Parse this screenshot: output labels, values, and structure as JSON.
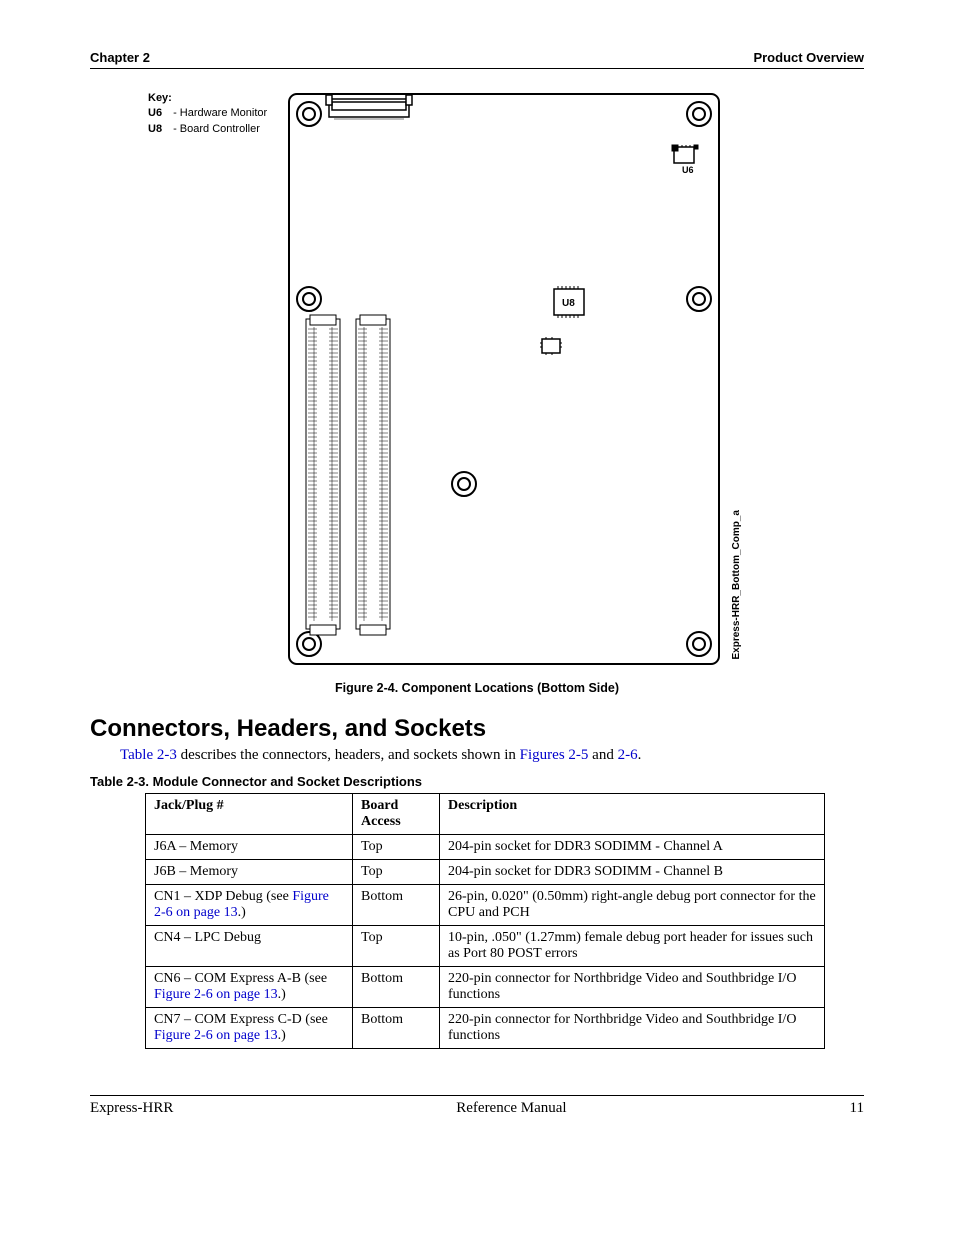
{
  "header": {
    "left": "Chapter 2",
    "right": "Product Overview"
  },
  "figure": {
    "key_title": "Key:",
    "key_items": [
      {
        "id": "U6",
        "desc": "- Hardware Monitor"
      },
      {
        "id": "U8",
        "desc": "- Board Controller"
      }
    ],
    "chip_u6": "U6",
    "chip_u8": "U8",
    "side_label": "Express-HRR_Bottom_Comp_a",
    "caption": "Figure  2-4.   Component Locations (Bottom Side)"
  },
  "section_title": "Connectors, Headers, and Sockets",
  "intro": {
    "pre": "",
    "link1": "Table 2-3",
    "mid": " describes the connectors, headers, and sockets shown in ",
    "link2": "Figures 2-5",
    "mid2": " and ",
    "link3": "2-6",
    "post": "."
  },
  "table": {
    "caption": "Table 2-3.   Module Connector and Socket Descriptions",
    "headers": [
      "Jack/Plug #",
      "Board Access",
      "Description"
    ],
    "rows": [
      {
        "col1_plain": "J6A – Memory",
        "col1_link": "",
        "col1_post": "",
        "col2": "Top",
        "col3": "204-pin socket for DDR3 SODIMM - Channel A"
      },
      {
        "col1_plain": "J6B – Memory",
        "col1_link": "",
        "col1_post": "",
        "col2": "Top",
        "col3": "204-pin socket for DDR3 SODIMM - Channel B"
      },
      {
        "col1_plain": "CN1 – XDP Debug (see ",
        "col1_link": "Figure 2-6 on page 13",
        "col1_post": ".)",
        "col2": "Bottom",
        "col3": "26-pin, 0.020\" (0.50mm) right-angle debug port connector for the CPU and PCH"
      },
      {
        "col1_plain": "CN4 – LPC Debug",
        "col1_link": "",
        "col1_post": "",
        "col2": "Top",
        "col3": "10-pin, .050\" (1.27mm) female debug port header for issues such as Port 80 POST errors"
      },
      {
        "col1_plain": "CN6 – COM Express A-B (see ",
        "col1_link": "Figure 2-6 on page 13",
        "col1_post": ".)",
        "col2": "Bottom",
        "col3": "220-pin connector for Northbridge Video and Southbridge I/O functions"
      },
      {
        "col1_plain": "CN7 – COM Express C-D (see ",
        "col1_link": "Figure 2-6 on page 13",
        "col1_post": ".)",
        "col2": "Bottom",
        "col3": "220-pin connector for Northbridge Video and Southbridge I/O functions"
      }
    ]
  },
  "footer": {
    "left": "Express-HRR",
    "center": "Reference Manual",
    "right": "11"
  }
}
